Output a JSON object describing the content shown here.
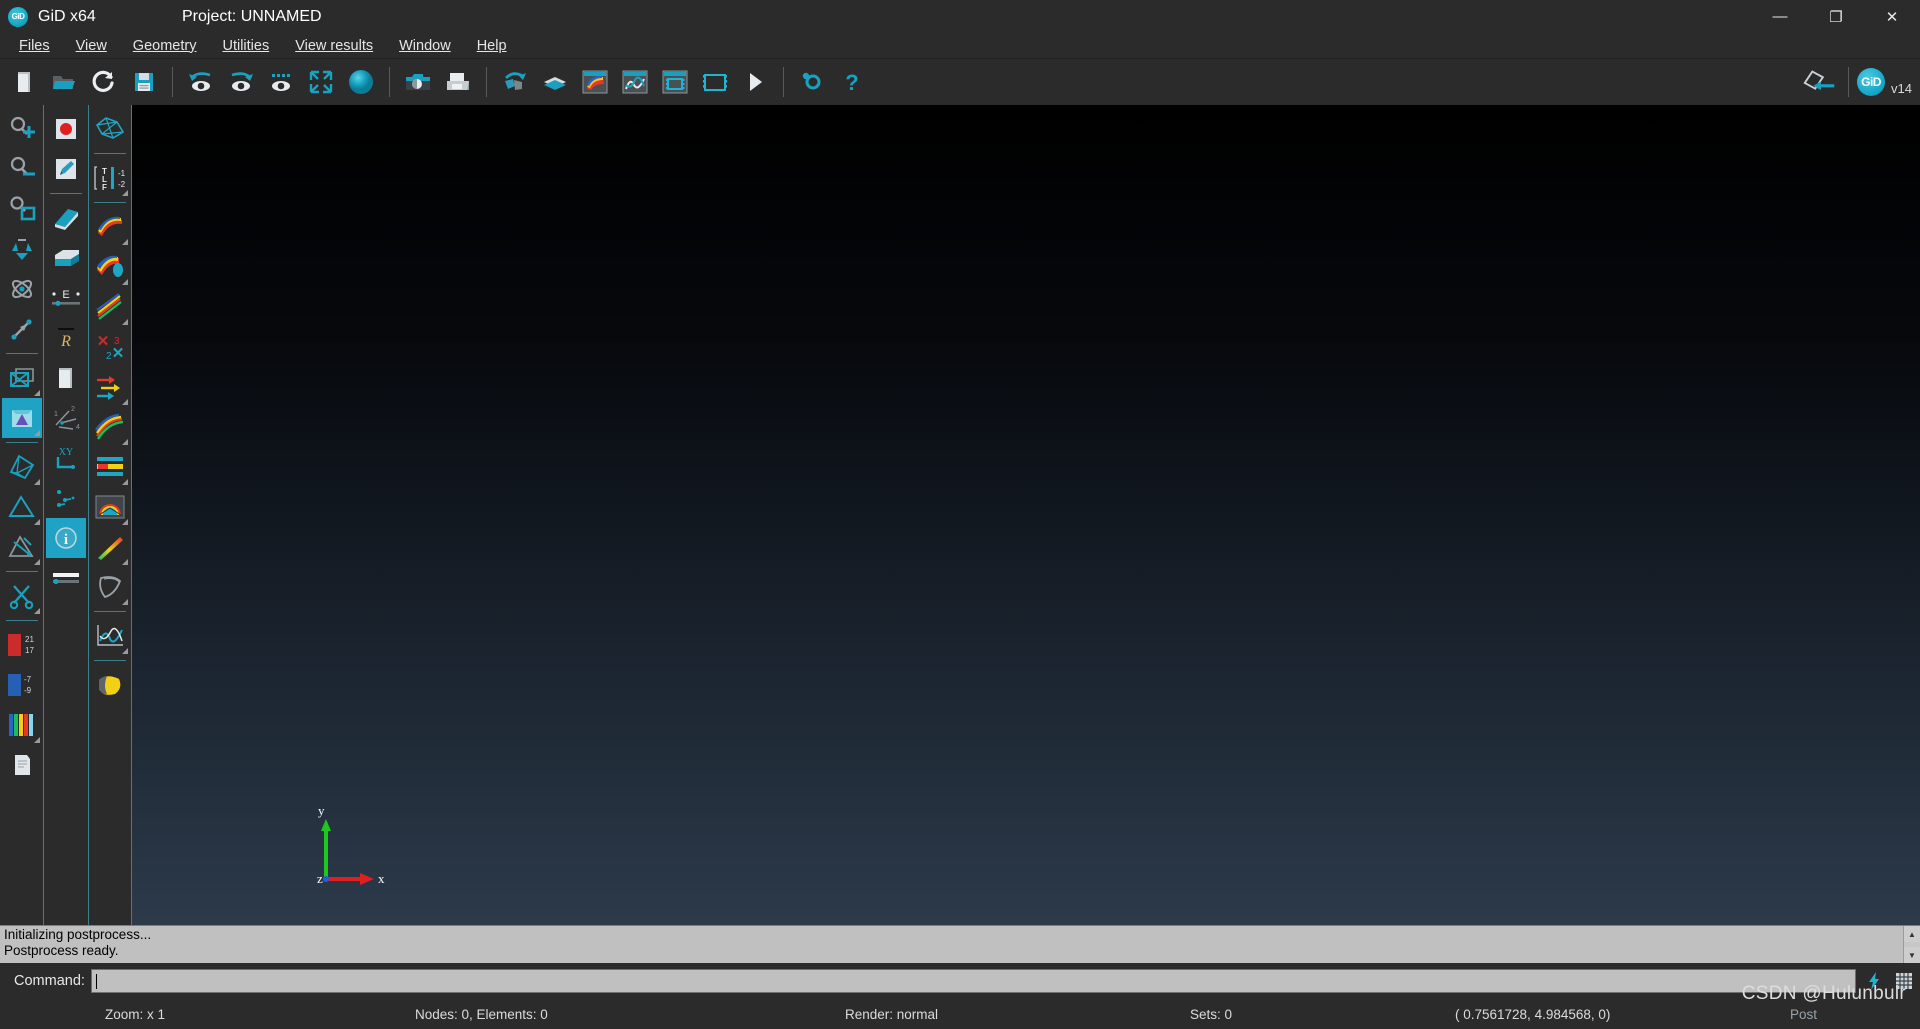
{
  "titlebar": {
    "app_logo": "gid-logo",
    "app_title": "GiD x64",
    "project_label": "Project: UNNAMED",
    "minimize": "—",
    "maximize": "❐",
    "close": "✕"
  },
  "menubar": {
    "items": [
      {
        "label": "Files",
        "accel": "F"
      },
      {
        "label": "View",
        "accel": "V"
      },
      {
        "label": "Geometry",
        "accel": "G"
      },
      {
        "label": "Utilities",
        "accel": "U"
      },
      {
        "label": "View results",
        "accel": "V"
      },
      {
        "label": "Window",
        "accel": "W"
      },
      {
        "label": "Help",
        "accel": "H"
      }
    ]
  },
  "toolbar": {
    "groups": [
      {
        "name": "file",
        "buttons": [
          {
            "name": "new-file-button",
            "icon": "new-page-icon"
          },
          {
            "name": "open-file-button",
            "icon": "open-folder-icon"
          },
          {
            "name": "reload-button",
            "icon": "refresh-icon"
          },
          {
            "name": "save-button",
            "icon": "floppy-save-icon"
          }
        ]
      },
      {
        "name": "view",
        "buttons": [
          {
            "name": "rotate-left-view-button",
            "icon": "eye-rotate-left-icon"
          },
          {
            "name": "rotate-right-view-button",
            "icon": "eye-rotate-right-icon"
          },
          {
            "name": "animate-view-button",
            "icon": "eye-dots-icon"
          },
          {
            "name": "zoom-frame-button",
            "icon": "zoom-fit-icon"
          },
          {
            "name": "render-sphere-button",
            "icon": "sphere-icon"
          }
        ]
      },
      {
        "name": "capture",
        "buttons": [
          {
            "name": "screenshot-button",
            "icon": "camera-icon"
          },
          {
            "name": "print-button",
            "icon": "printer-icon"
          }
        ]
      },
      {
        "name": "results",
        "buttons": [
          {
            "name": "rotate-model-button",
            "icon": "rotate-cube-icon"
          },
          {
            "name": "layers-button",
            "icon": "layers-icon"
          },
          {
            "name": "contour-fill-button",
            "icon": "contour-fill-icon"
          },
          {
            "name": "graph-button",
            "icon": "graph-curve-icon"
          },
          {
            "name": "window-results-button",
            "icon": "result-window-icon"
          },
          {
            "name": "animation-button",
            "icon": "film-strip-icon"
          },
          {
            "name": "play-animation-button",
            "icon": "play-icon"
          }
        ]
      },
      {
        "name": "settings",
        "buttons": [
          {
            "name": "preferences-button",
            "icon": "gear-icon"
          },
          {
            "name": "help-button",
            "icon": "question-mark-icon"
          }
        ]
      }
    ],
    "right": {
      "back-to-geometry-button": "diamond-arrow-icon",
      "gid_badge": "GiD",
      "version": "v14"
    }
  },
  "sidebar_col1": {
    "items": [
      {
        "name": "zoom-in-tool",
        "icon": "magnifier-plus-icon"
      },
      {
        "name": "zoom-out-tool",
        "icon": "magnifier-minus-icon"
      },
      {
        "name": "zoom-window-tool",
        "icon": "magnifier-frame-icon"
      },
      {
        "name": "rotate-tool",
        "icon": "rotate-arrows-icon"
      },
      {
        "name": "rotate-trackball-tool",
        "icon": "trackball-icon"
      },
      {
        "name": "pan-tool",
        "icon": "pan-arrow-icon"
      },
      {
        "name": "no-results-view-tool",
        "icon": "box-cross-icon",
        "selected": false
      },
      {
        "name": "geometry-view-tool",
        "icon": "cube-prism-icon",
        "selected": true
      },
      {
        "name": "volume-tool",
        "icon": "polyhedron-icon"
      },
      {
        "name": "surface-tool",
        "icon": "triangle-icon"
      },
      {
        "name": "cut-surface-tool",
        "icon": "triangle-cut-icon"
      },
      {
        "name": "scissors-tool",
        "icon": "scissors-icon"
      },
      {
        "name": "contour-range-tool",
        "icon": "red-range-icon",
        "labels": [
          "21",
          "17"
        ]
      },
      {
        "name": "contour-range-blue-tool",
        "icon": "blue-range-icon",
        "labels": [
          "-7",
          "-9"
        ]
      },
      {
        "name": "color-scale-tool",
        "icon": "color-bars-icon"
      },
      {
        "name": "report-tool",
        "icon": "document-icon"
      }
    ]
  },
  "sidebar_col2": {
    "items": [
      {
        "name": "record-view-tool",
        "icon": "red-dot-icon"
      },
      {
        "name": "annotate-tool",
        "icon": "pencil-note-icon"
      },
      {
        "name": "cut-plane-tool",
        "icon": "cut-plane-icon"
      },
      {
        "name": "volume-box-tool",
        "icon": "open-box-icon"
      },
      {
        "name": "scale-e-tool",
        "icon": "e-scale-icon"
      },
      {
        "name": "font-tool",
        "icon": "r-font-icon"
      },
      {
        "name": "page-tool",
        "icon": "page-icon"
      },
      {
        "name": "local-axes-tool",
        "icon": "local-axes-icon"
      },
      {
        "name": "xy-axes-tool",
        "icon": "xy-axes-icon"
      },
      {
        "name": "nodes-tool",
        "icon": "scatter-nodes-icon"
      },
      {
        "name": "info-tool",
        "icon": "info-icon",
        "selected": true
      },
      {
        "name": "legend-bar-tool",
        "icon": "legend-bar-icon"
      }
    ]
  },
  "sidebar_col3": {
    "items": [
      {
        "name": "mesh-view-tool",
        "icon": "mesh-wire-icon"
      },
      {
        "name": "label-tlf-tool",
        "icon": "tlf-label-icon"
      },
      {
        "name": "contour-smooth-tool",
        "icon": "contour-ribbon-icon"
      },
      {
        "name": "contour-gradient-tool",
        "icon": "contour-gradient-icon"
      },
      {
        "name": "contour-lines-tool",
        "icon": "contour-lines-icon"
      },
      {
        "name": "x3-x2-tool",
        "icon": "x3-2x-icon"
      },
      {
        "name": "vector-arrows-tool",
        "icon": "arrows-rgb-icon"
      },
      {
        "name": "stream-lines-tool",
        "icon": "stream-lines-icon"
      },
      {
        "name": "iso-surfaces-tool",
        "icon": "iso-bands-icon"
      },
      {
        "name": "result-surface-tool",
        "icon": "rainbow-dome-icon"
      },
      {
        "name": "beam-diagram-tool",
        "icon": "gradient-beam-icon"
      },
      {
        "name": "deformation-tool",
        "icon": "deformed-shape-icon"
      },
      {
        "name": "graph-plot-tool",
        "icon": "graph-plot-icon"
      },
      {
        "name": "stream-ribbon-tool",
        "icon": "yellow-ribbon-icon"
      }
    ]
  },
  "canvas": {
    "axes": {
      "x_label": "x",
      "y_label": "y",
      "z_label": "z",
      "x_color": "#e02020",
      "y_color": "#1ec81e",
      "z_color": "#2060e0"
    }
  },
  "console": {
    "lines": [
      "Initializing postprocess...",
      "Postprocess ready."
    ],
    "scroll_up": "▲",
    "scroll_down": "▼"
  },
  "command": {
    "label": "Command:",
    "value": "",
    "placeholder": "",
    "lightning_icon": "lightning-bolt-icon",
    "grid_icon": "grid-icon"
  },
  "statusbar": {
    "zoom": "Zoom: x 1",
    "mesh": "Nodes: 0, Elements: 0",
    "render": "Render: normal",
    "sets": "Sets: 0",
    "coords": "( 0.7561728, 4.984568, 0)",
    "mode": "Post"
  },
  "watermark": "CSDN @Hulunbuir",
  "colors": {
    "accent": "#1fa2c4",
    "panel": "#2b2b2b",
    "console": "#c0c0c0",
    "separator": "#3f7f8c"
  }
}
